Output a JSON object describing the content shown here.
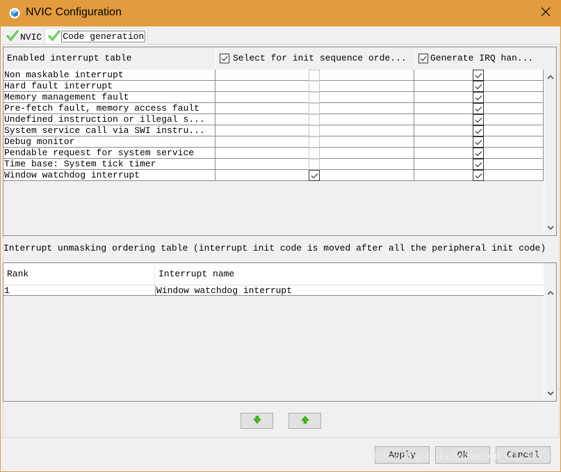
{
  "window": {
    "title": "NVIC Configuration",
    "title_bar_color": "#e29c3e",
    "close_icon": "close-icon"
  },
  "tabs": [
    {
      "label": "NVIC",
      "icon": "green-check-icon",
      "active": false
    },
    {
      "label": "Code generation",
      "icon": "green-check-icon",
      "active": true
    }
  ],
  "enabled_table": {
    "headers": {
      "col0": "Enabled interrupt table",
      "col1": "Select for init sequence orde...",
      "col1_checked": true,
      "col2": "Generate IRQ han...",
      "col2_checked": true
    },
    "rows": [
      {
        "name": "Non maskable interrupt",
        "init_sequence": false,
        "generate_irq": true
      },
      {
        "name": "Hard fault interrupt",
        "init_sequence": false,
        "generate_irq": true
      },
      {
        "name": "Memory management fault",
        "init_sequence": false,
        "generate_irq": true
      },
      {
        "name": "Pre-fetch fault, memory access fault",
        "init_sequence": false,
        "generate_irq": true
      },
      {
        "name": "Undefined instruction or illegal s...",
        "init_sequence": false,
        "generate_irq": true
      },
      {
        "name": "System service call via SWI instru...",
        "init_sequence": false,
        "generate_irq": true
      },
      {
        "name": "Debug monitor",
        "init_sequence": false,
        "generate_irq": true
      },
      {
        "name": "Pendable request for system service",
        "init_sequence": false,
        "generate_irq": true
      },
      {
        "name": "Time base: System tick timer",
        "init_sequence": false,
        "generate_irq": true
      },
      {
        "name": "Window watchdog interrupt",
        "init_sequence": true,
        "generate_irq": true
      }
    ]
  },
  "ordering_section": {
    "label": "Interrupt unmasking ordering table (interrupt init code is moved after all the peripheral init code)",
    "headers": {
      "rank": "Rank",
      "name": "Interrupt name"
    },
    "rows": [
      {
        "rank": "1",
        "name": "Window watchdog interrupt"
      }
    ]
  },
  "move_buttons": {
    "down_icon": "green-arrow-down-icon",
    "up_icon": "green-arrow-up-icon"
  },
  "footer": {
    "apply_label": "Apply",
    "ok_label": "Ok",
    "cancel_label": "Cancel"
  },
  "watermark": "https://blog.csdn.net/weixin_41738734"
}
